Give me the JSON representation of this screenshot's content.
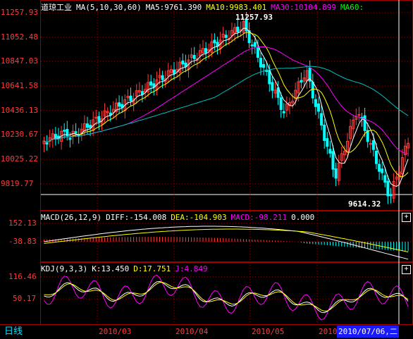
{
  "price_header": {
    "name": "道琼工业",
    "ma_label": "MA(5,10,30,60)",
    "ma5": "MA5:9761.390",
    "ma10": "MA10:9983.401",
    "ma30": "MA30:10104.899",
    "ma60": "MA60:"
  },
  "price_axis": [
    "11257.93",
    "11052.48",
    "10847.03",
    "10641.58",
    "10436.13",
    "10230.67",
    "10025.22",
    "9819.77"
  ],
  "price_annotations": {
    "high": "11257.93",
    "low": "9614.32"
  },
  "macd_header": {
    "label": "MACD(26,12,9)",
    "diff": "DIFF:-154.008",
    "dea": "DEA:-104.903",
    "macd": "MACD:-98.211",
    "zero": "0.000"
  },
  "macd_axis": [
    "152.13",
    "-38.83"
  ],
  "kdj_header": {
    "label": "KDJ(9,3,3)",
    "k": "K:13.450",
    "d": "D:17.751",
    "j": "J:4.849"
  },
  "kdj_axis": [
    "116.46",
    "50.17"
  ],
  "x_axis": [
    "2010/03",
    "2010/04",
    "2010/05",
    "2010/06"
  ],
  "period": "日线",
  "cursor_date": "2010/07/06,二",
  "plus_symbol": "+",
  "colors": {
    "up": "#ff3b3b",
    "down": "#00ffff",
    "ma5": "#ffffff",
    "ma10": "#ffff00",
    "ma30": "#ff00ff",
    "ma60": "#00c0c0",
    "axis": "#ff3b3b",
    "grid": "#a00000"
  },
  "chart_data": [
    {
      "type": "candlestick",
      "title": "道琼工业",
      "ylim": [
        9614.32,
        11257.93
      ],
      "x_ticks": [
        "2010/03",
        "2010/04",
        "2010/05",
        "2010/06"
      ],
      "high": 11257.93,
      "low": 9614.32,
      "series": [
        {
          "name": "MA5",
          "last": 9761.39
        },
        {
          "name": "MA10",
          "last": 9983.401
        },
        {
          "name": "MA30",
          "last": 10104.899
        },
        {
          "name": "MA60"
        }
      ]
    },
    {
      "type": "bar",
      "title": "MACD(26,12,9)",
      "series": [
        {
          "name": "DIFF",
          "last": -154.008
        },
        {
          "name": "DEA",
          "last": -104.903
        },
        {
          "name": "MACD",
          "last": -98.211
        }
      ]
    },
    {
      "type": "line",
      "title": "KDJ(9,3,3)",
      "series": [
        {
          "name": "K",
          "last": 13.45
        },
        {
          "name": "D",
          "last": 17.751
        },
        {
          "name": "J",
          "last": 4.849
        }
      ]
    }
  ]
}
